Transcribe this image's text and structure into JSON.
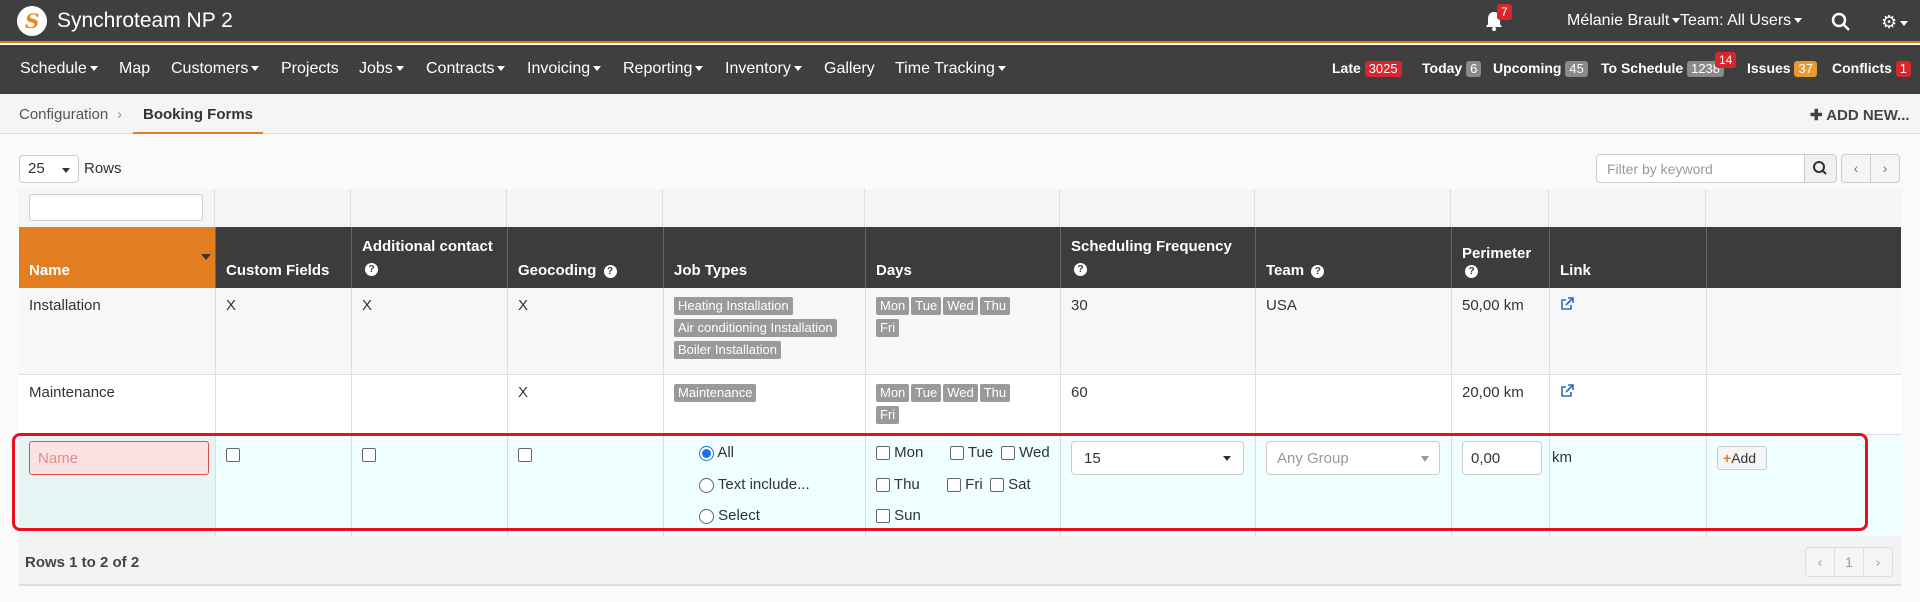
{
  "app": {
    "title": "Synchroteam NP 2",
    "logo_letter": "S"
  },
  "topbar": {
    "notifications_count": "7",
    "user": "Mélanie Brault",
    "team": "Team: All Users"
  },
  "nav": {
    "items": [
      {
        "label": "Schedule",
        "dropdown": true
      },
      {
        "label": "Map",
        "dropdown": false
      },
      {
        "label": "Customers",
        "dropdown": true
      },
      {
        "label": "Projects",
        "dropdown": false
      },
      {
        "label": "Jobs",
        "dropdown": true
      },
      {
        "label": "Contracts",
        "dropdown": true
      },
      {
        "label": "Invoicing",
        "dropdown": true
      },
      {
        "label": "Reporting",
        "dropdown": true
      },
      {
        "label": "Inventory",
        "dropdown": true
      },
      {
        "label": "Gallery",
        "dropdown": false
      },
      {
        "label": "Time Tracking",
        "dropdown": true
      }
    ],
    "stats": {
      "late_label": "Late",
      "late_count": "3025",
      "today_label": "Today",
      "today_count": "6",
      "upcoming_label": "Upcoming",
      "upcoming_count": "45",
      "toschedule_label": "To Schedule",
      "toschedule_count": "1238",
      "toschedule_new": "14",
      "issues_label": "Issues",
      "issues_count": "37",
      "conflicts_label": "Conflicts",
      "conflicts_count": "1"
    }
  },
  "breadcrumb": {
    "parent": "Configuration",
    "current": "Booking Forms",
    "add_new": "ADD NEW..."
  },
  "toolbar": {
    "rows_value": "25",
    "rows_label": "Rows",
    "filter_placeholder": "Filter by keyword"
  },
  "table": {
    "headers": {
      "name": "Name",
      "custom_fields": "Custom Fields",
      "additional_contact": "Additional contact",
      "geocoding": "Geocoding",
      "job_types": "Job Types",
      "days": "Days",
      "scheduling_frequency": "Scheduling Frequency",
      "team": "Team",
      "perimeter": "Perimeter",
      "link": "Link"
    },
    "rows": [
      {
        "name": "Installation",
        "custom_fields": "X",
        "additional_contact": "X",
        "geocoding": "X",
        "job_types": [
          "Heating Installation",
          "Air conditioning Installation",
          "Boiler Installation"
        ],
        "days": [
          "Mon",
          "Tue",
          "Wed",
          "Thu",
          "Fri"
        ],
        "frequency": "30",
        "team": "USA",
        "perimeter": "50,00 km"
      },
      {
        "name": "Maintenance",
        "custom_fields": "",
        "additional_contact": "",
        "geocoding": "X",
        "job_types": [
          "Maintenance"
        ],
        "days": [
          "Mon",
          "Tue",
          "Wed",
          "Thu",
          "Fri"
        ],
        "frequency": "60",
        "team": "",
        "perimeter": "20,00 km"
      }
    ],
    "add_row": {
      "name_placeholder": "Name",
      "job_type_options": [
        "All",
        "Text include...",
        "Select"
      ],
      "job_type_selected": "All",
      "day_options": [
        "Mon",
        "Tue",
        "Wed",
        "Thu",
        "Fri",
        "Sat",
        "Sun"
      ],
      "frequency_value": "15",
      "team_placeholder": "Any Group",
      "perimeter_value": "0,00",
      "perimeter_unit": "km",
      "add_label": "Add"
    }
  },
  "footer": {
    "summary": "Rows 1 to 2 of 2",
    "page": "1"
  },
  "colors": {
    "accent": "#e27e1f",
    "header_dark": "#3c3c3c",
    "badge_red": "#d9262c",
    "highlight": "#e8101f"
  }
}
